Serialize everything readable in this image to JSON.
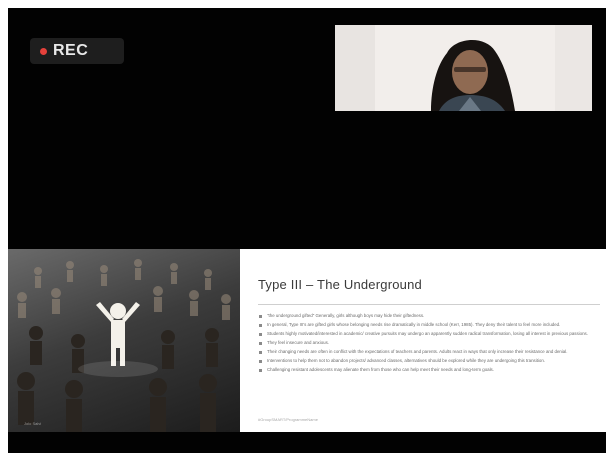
{
  "recording": {
    "label": "REC"
  },
  "colors": {
    "rec_dot": "#e5413b",
    "background": "#020202",
    "slide_bg": "#ffffff"
  },
  "participant_video": {
    "icon": "webcam-feed"
  },
  "slide": {
    "image_icon": "crowd-with-highlighted-figure",
    "title": "Type III – The Underground",
    "bullets": [
      "\"the underground gifted\" Generally, girls although boys may hide their giftedness.",
      "In general, Type III's are gifted girls whose belonging needs rise dramatically in middle school (Kerr, 1985). They deny their talent to feel more included.",
      "Students highly motivated/interested in academic/ creative pursuits may undergo an apparently sudden radical transformation, losing all interest in previous passions.",
      "They feel insecure and anxious.",
      "Their changing needs are often in conflict with the expectations of teachers and parents. Adults react in ways that only increase their resistance and denial.",
      "Interventions to help them not to abandon projects/ advanced classes, alternatives should be explored while they are undergoing this transition.",
      "Challenging resistant adolescents may alienate them from those who can help meet their needs and long-term goals."
    ],
    "footer": "#GroupSMART/ProgrammeName",
    "image_credit": "Jolo Salvi"
  }
}
